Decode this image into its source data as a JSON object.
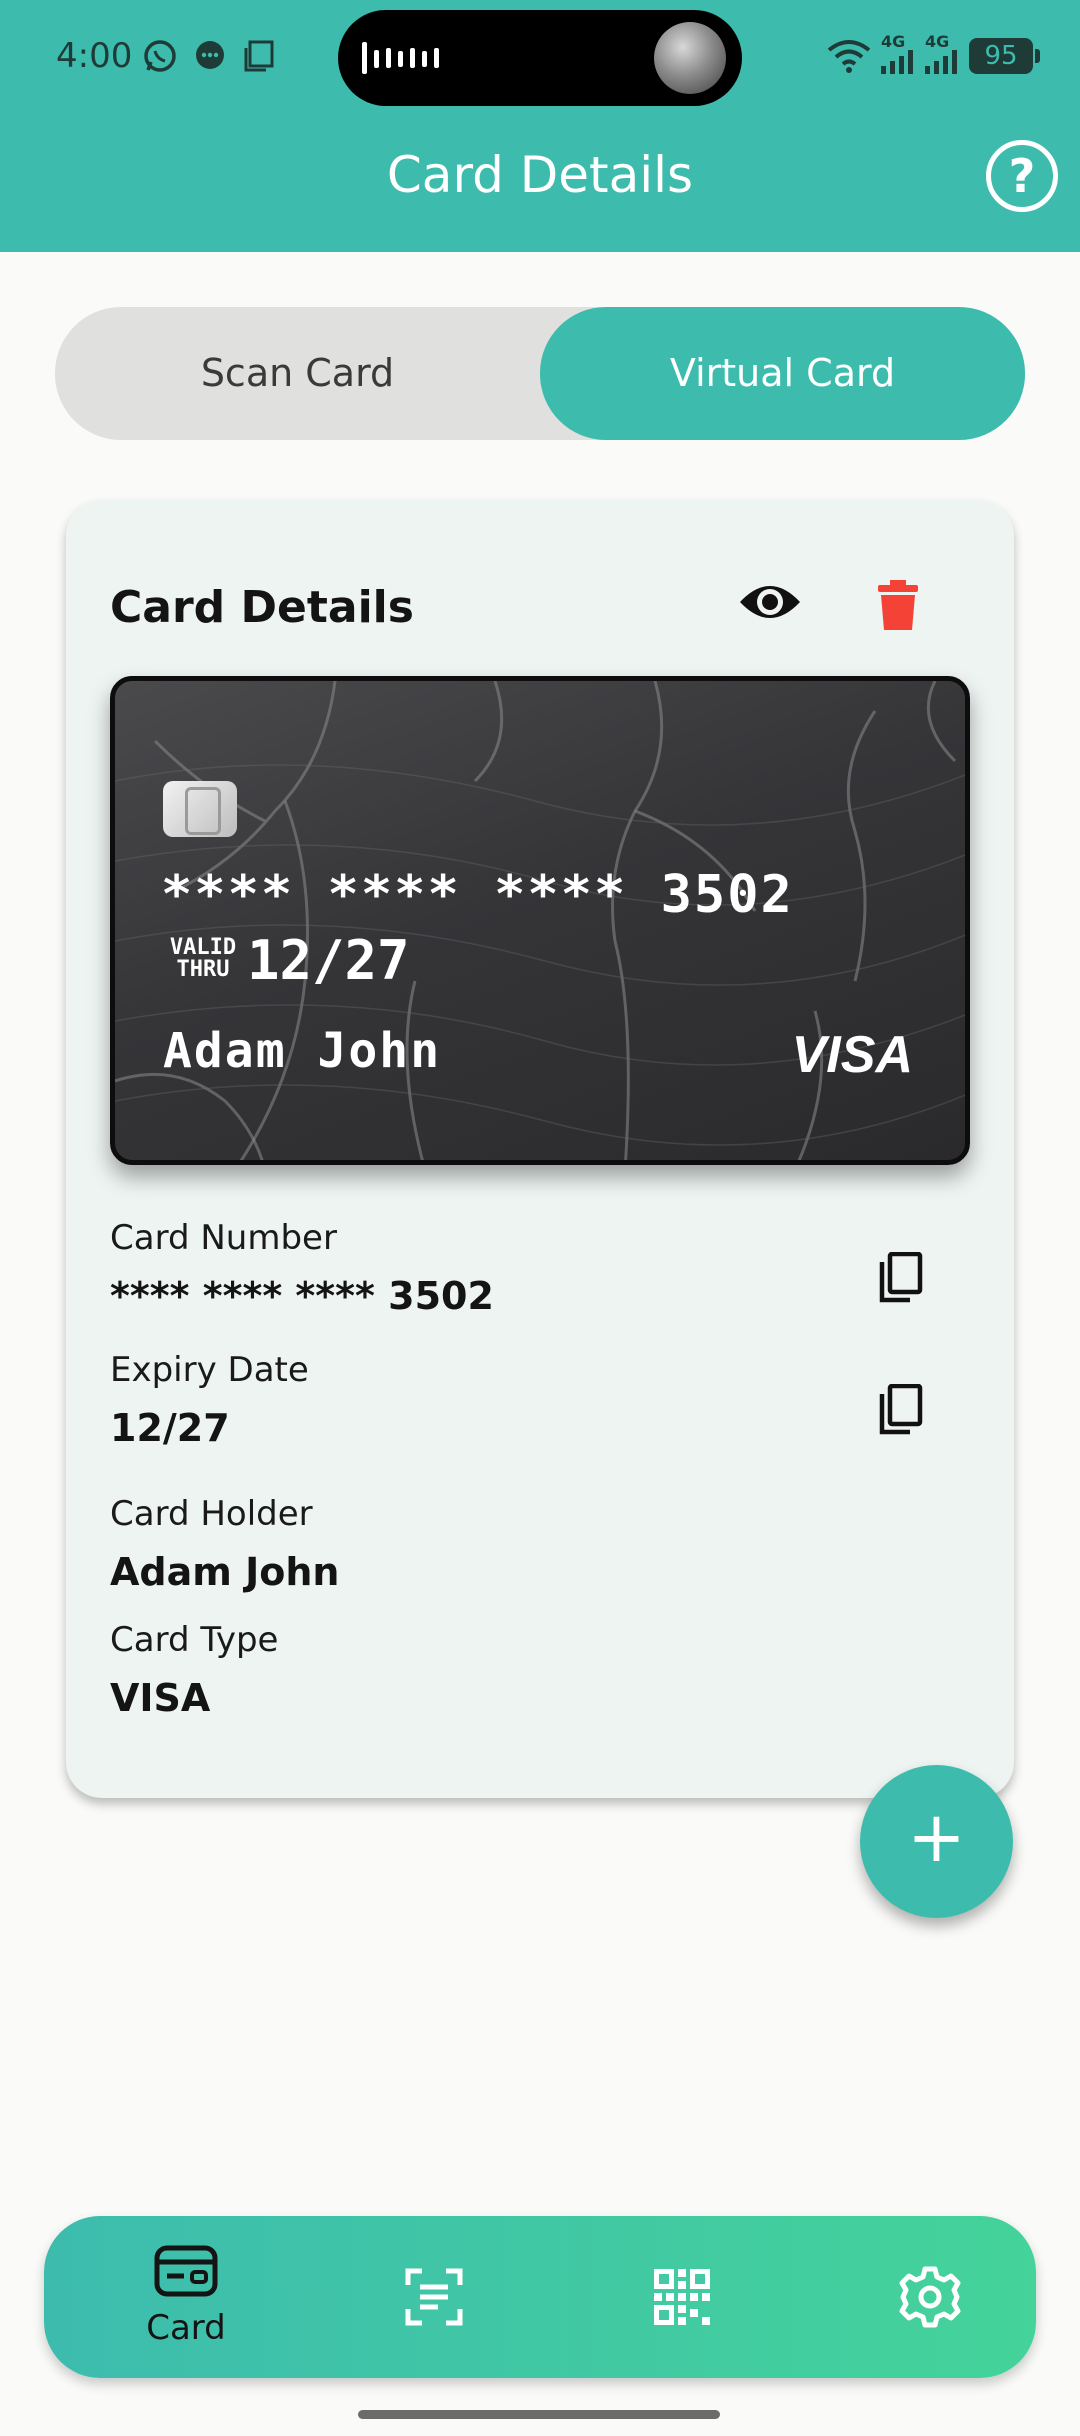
{
  "status_bar": {
    "time": "4:00",
    "network_1": "4G",
    "network_2": "4G",
    "battery": "95"
  },
  "app_bar": {
    "title": "Card Details",
    "help_icon": "help-circle-icon"
  },
  "segment": {
    "options": [
      "Scan Card",
      "Virtual Card"
    ],
    "selected": "Virtual Card"
  },
  "panel": {
    "title": "Card Details",
    "actions": [
      "eye-icon",
      "trash-icon"
    ],
    "card": {
      "number": "**** **** **** 3502",
      "valid_label": "VALID THRU",
      "valid_line1": "VALID",
      "valid_line2": "THRU",
      "expiry": "12/27",
      "holder": "Adam John",
      "brand": "VISA"
    },
    "fields": [
      {
        "label": "Card Number",
        "value": "**** **** **** 3502",
        "copyable": true
      },
      {
        "label": "Expiry Date",
        "value": "12/27",
        "copyable": true
      },
      {
        "label": "Card Holder",
        "value": "Adam John",
        "copyable": false
      },
      {
        "label": "Card Type",
        "value": "VISA",
        "copyable": false
      }
    ]
  },
  "fab": {
    "label": "+",
    "icon": "plus-icon"
  },
  "bottom_nav": {
    "items": [
      {
        "label": "Card",
        "icon": "card-icon",
        "active": true
      },
      {
        "label": "",
        "icon": "scan-text-icon",
        "active": false
      },
      {
        "label": "",
        "icon": "qr-code-icon",
        "active": false
      },
      {
        "label": "",
        "icon": "settings-gear-icon",
        "active": false
      }
    ]
  },
  "colors": {
    "primary": "#3DBCAE",
    "nav_gradient_end": "#44D39A",
    "danger": "#F44336",
    "panel_bg": "#EEF4F2"
  }
}
